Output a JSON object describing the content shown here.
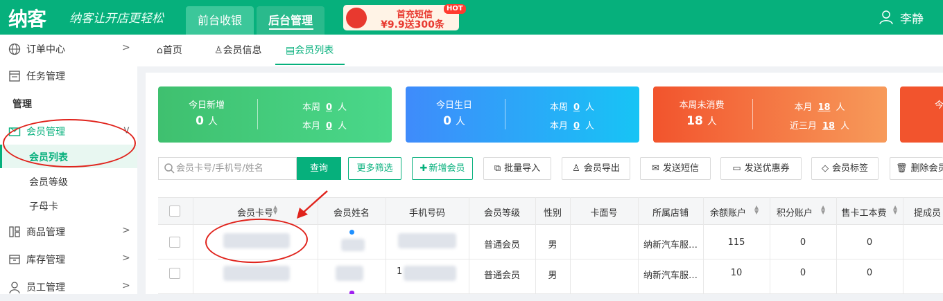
{
  "header": {
    "logo": "纳客",
    "slogan": "纳客让开店更轻松",
    "nav": [
      {
        "label": "前台收银"
      },
      {
        "label": "后台管理"
      }
    ],
    "promo": {
      "badge": "HOT",
      "line1": "首充短信",
      "line2": "¥9.9送300条"
    },
    "user": "李静"
  },
  "sidebar": {
    "items": [
      {
        "label": "订单中心",
        "icon": "globe-icon"
      },
      {
        "label": "任务管理",
        "icon": "task-icon"
      },
      {
        "label": "管理"
      },
      {
        "label": "会员管理",
        "icon": "member-icon"
      },
      {
        "label": "商品管理",
        "icon": "product-icon"
      },
      {
        "label": "库存管理",
        "icon": "inventory-icon"
      },
      {
        "label": "员工管理",
        "icon": "staff-icon"
      }
    ],
    "submenu": [
      "会员列表",
      "会员等级",
      "子母卡"
    ]
  },
  "tabs": [
    {
      "label": "首页",
      "icon": "home-icon"
    },
    {
      "label": "会员信息",
      "icon": "user-icon"
    },
    {
      "label": "会员列表",
      "icon": "clipboard-icon"
    }
  ],
  "stats": [
    {
      "title": "今日新增",
      "value": "0",
      "unit": "人",
      "r1_label": "本周",
      "r1_value": "0",
      "r2_label": "本月",
      "r2_value": "0"
    },
    {
      "title": "今日生日",
      "value": "0",
      "unit": "人",
      "r1_label": "本周",
      "r1_value": "0",
      "r2_label": "本月",
      "r2_value": "0"
    },
    {
      "title": "本周未消费",
      "value": "18",
      "unit": "人",
      "r1_label": "本月",
      "r1_value": "18",
      "r2_label": "近三月",
      "r2_value": "18"
    },
    {
      "title": "今"
    }
  ],
  "toolbar": {
    "search_placeholder": "会员卡号/手机号/姓名",
    "search_button": "查询",
    "more_filter": "更多筛选",
    "add_member": "新增会员",
    "bulk_import": "批量导入",
    "export": "会员导出",
    "send_sms": "发送短信",
    "send_coupon": "发送优惠券",
    "member_tag": "会员标签",
    "delete_member": "删除会员"
  },
  "table": {
    "columns": [
      "会员卡号",
      "会员姓名",
      "手机号码",
      "会员等级",
      "性别",
      "卡面号",
      "所属店铺",
      "余额账户",
      "积分账户",
      "售卡工本费",
      "提成员"
    ],
    "rows": [
      {
        "level": "普通会员",
        "gender": "男",
        "store": "纳新汽车服…",
        "balance": "115",
        "points": "0",
        "fee": "0"
      },
      {
        "level": "普通会员",
        "gender": "男",
        "store": "纳新汽车服…",
        "balance": "10",
        "points": "0",
        "fee": "0",
        "phone_partial": "1"
      }
    ]
  },
  "colors": {
    "primary": "#06b07c",
    "annotation": "#e0231c"
  }
}
